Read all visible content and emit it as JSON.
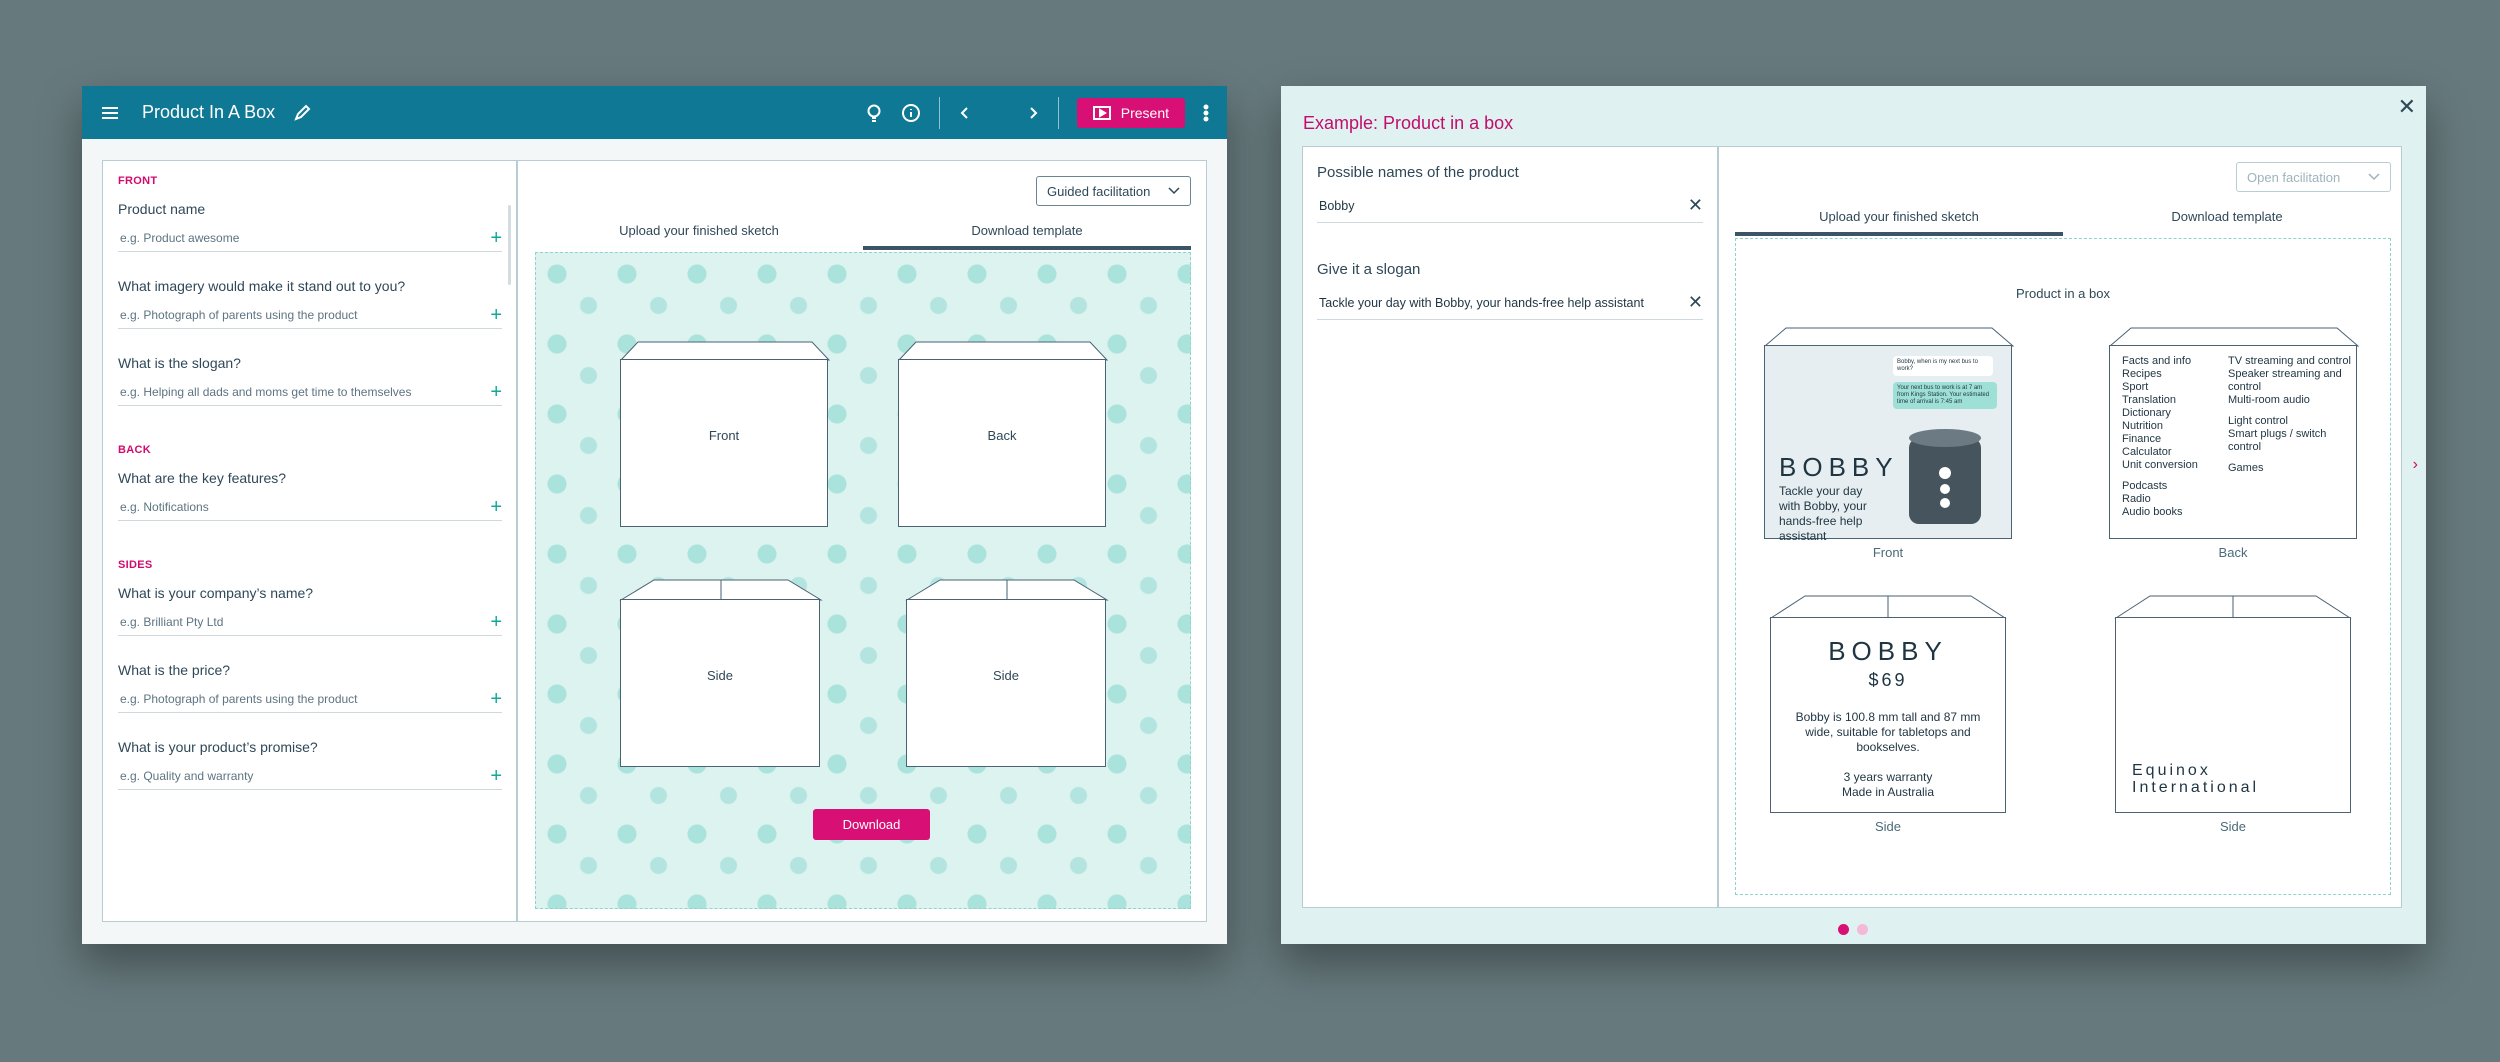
{
  "app": {
    "title": "Product In A Box",
    "present_label": "Present",
    "guided": "Guided facilitation"
  },
  "left": {
    "sections": [
      {
        "name": "FRONT",
        "items": [
          {
            "q": "Product name",
            "ph": "e.g. Product awesome"
          },
          {
            "q": "What imagery would make it stand out to you?",
            "ph": "e.g. Photograph of parents using the product"
          },
          {
            "q": "What is the slogan?",
            "ph": "e.g. Helping all dads and moms get time to themselves"
          }
        ]
      },
      {
        "name": "BACK",
        "items": [
          {
            "q": "What are the key features?",
            "ph": "e.g. Notifications"
          }
        ]
      },
      {
        "name": "SIDES",
        "items": [
          {
            "q": "What is your company’s name?",
            "ph": "e.g. Brilliant Pty Ltd"
          },
          {
            "q": "What is the price?",
            "ph": "e.g. Photograph of parents using the product"
          },
          {
            "q": "What is your product’s promise?",
            "ph": "e.g. Quality and warranty"
          }
        ]
      }
    ]
  },
  "tabs": {
    "upload": "Upload your finished sketch",
    "download": "Download template"
  },
  "template": {
    "front": "Front",
    "back": "Back",
    "side1": "Side",
    "side2": "Side",
    "download_btn": "Download"
  },
  "example": {
    "heading": "Example: Product in a box",
    "names_label": "Possible names of the product",
    "names_value": "Bobby",
    "slogan_label": "Give it a slogan",
    "slogan_value": "Tackle your day with Bobby, your hands-free help assistant",
    "open": "Open facilitation",
    "canvas_title": "Product in a box",
    "front": {
      "brand": "BOBBY",
      "tagline": "Tackle your day with Bobby, your hands-free help assistant",
      "bubble1": "Bobby, when is my next bus to work?",
      "bubble2": "Your next bus to work is at 7 am from Kings Station. Your estimated time of arrival is 7:45 am",
      "caption": "Front"
    },
    "back": {
      "col1": [
        "Facts and info",
        "Recipes",
        "Sport",
        "Translation",
        "Dictionary",
        "Nutrition",
        "Finance",
        "Calculator",
        "Unit conversion",
        "",
        "Podcasts",
        "Radio",
        "Audio books"
      ],
      "col2": [
        "TV streaming and control",
        "Speaker streaming and control",
        "Multi-room audio",
        "",
        "Light control",
        "Smart plugs / switch control",
        "",
        "Games"
      ],
      "caption": "Back"
    },
    "side1": {
      "brand": "BOBBY",
      "price": "$69",
      "desc": "Bobby is 100.8 mm tall and 87 mm wide, suitable for tabletops and bookselves.",
      "warranty": "3 years warranty",
      "made": "Made in Australia",
      "caption": "Side"
    },
    "side2": {
      "company": "Equinox International",
      "caption": "Side"
    }
  },
  "colors": {
    "accent": "#d80f74",
    "topbar": "#0f7894",
    "teal": "#12a99a"
  }
}
